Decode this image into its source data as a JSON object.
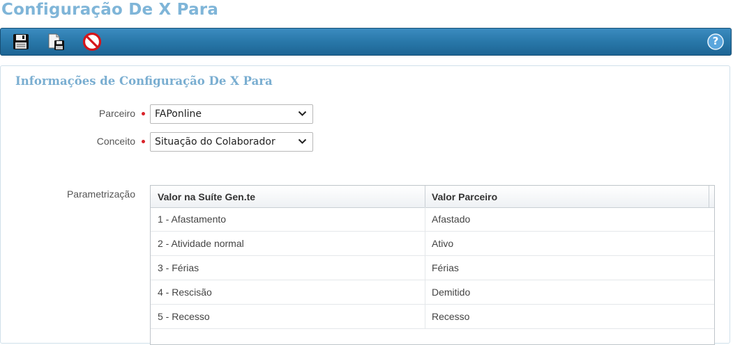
{
  "page": {
    "title": "Configuração De X Para"
  },
  "toolbar": {
    "buttons": [
      {
        "icon": "floppy-disk-icon"
      },
      {
        "icon": "save-as-icon"
      },
      {
        "icon": "cancel-icon"
      }
    ],
    "help_label": "?"
  },
  "section": {
    "title": "Informações de Configuração De X Para"
  },
  "form": {
    "parceiro": {
      "label": "Parceiro",
      "value": "FAPonline"
    },
    "conceito": {
      "label": "Conceito",
      "value": "Situação do Colaborador"
    },
    "parametrizacao": {
      "label": "Parametrização"
    }
  },
  "grid": {
    "columns": [
      "Valor na Suíte Gen.te",
      "Valor Parceiro"
    ],
    "rows": [
      [
        "1 - Afastamento",
        "Afastado"
      ],
      [
        "2 - Atividade normal",
        "Ativo"
      ],
      [
        "3 - Férias",
        "Férias"
      ],
      [
        "4 - Rescisão",
        "Demitido"
      ],
      [
        "5 - Recesso",
        "Recesso"
      ]
    ]
  },
  "colors": {
    "accent": "#7fb5d8",
    "toolbar": "#2a79ab",
    "required": "#d9232a"
  }
}
